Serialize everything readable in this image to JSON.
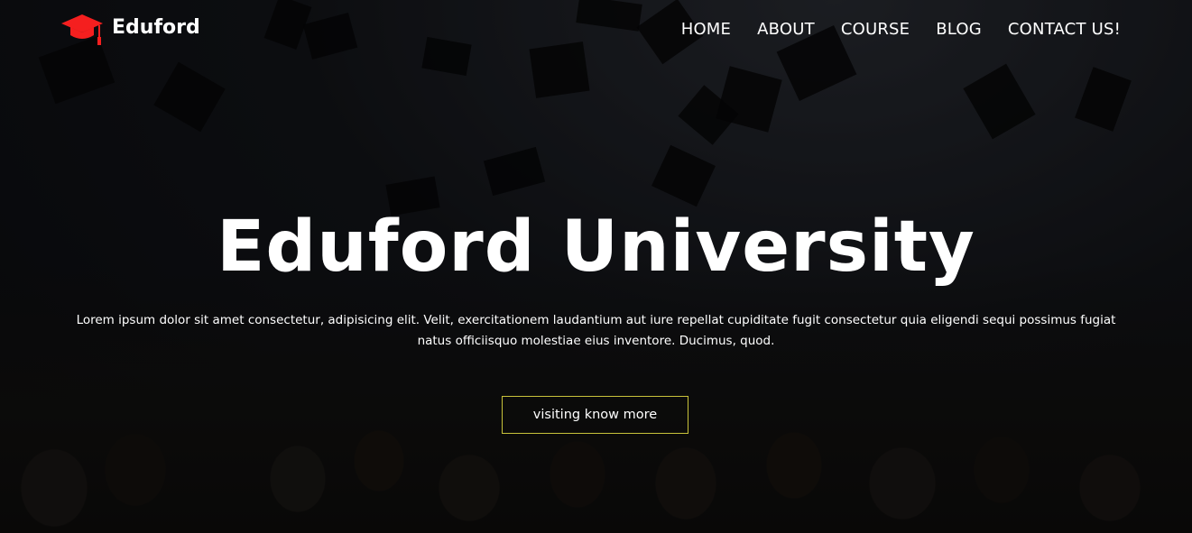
{
  "brand": {
    "name": "Eduford",
    "logo_icon": "graduation-cap-icon",
    "logo_color": "#f51f1f"
  },
  "nav": {
    "items": [
      {
        "label": "HOME"
      },
      {
        "label": "ABOUT"
      },
      {
        "label": "COURSE"
      },
      {
        "label": "BLOG"
      },
      {
        "label": "CONTACT US!"
      }
    ]
  },
  "hero": {
    "title": "Eduford University",
    "description": "Lorem ipsum dolor sit amet consectetur, adipisicing elit. Velit, exercitationem laudantium aut iure repellat cupiditate fugit consectetur quia eligendi sequi possimus fugiat natus officiisquo molestiae eius inventore. Ducimus, quod.",
    "cta_label": "visiting know more",
    "cta_border_color": "#c8c23a"
  }
}
